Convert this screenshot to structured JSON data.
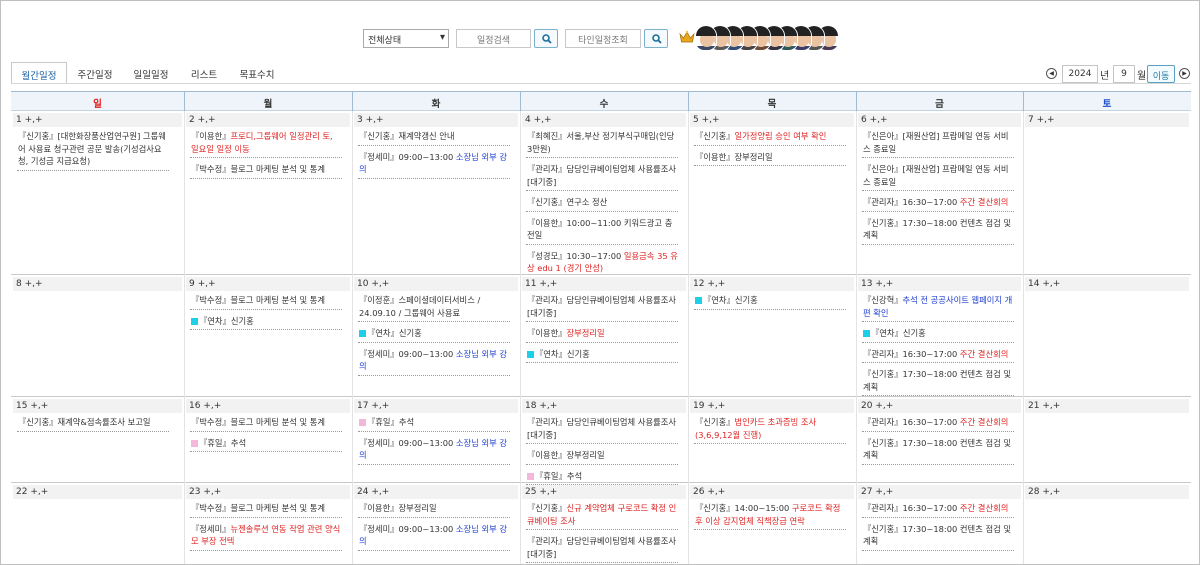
{
  "toolbar": {
    "status_select": "전체상태",
    "schedule_search_placeholder": "일정검색",
    "other_schedule_placeholder": "타인일정조회",
    "avatar_count": 10
  },
  "tabs": [
    {
      "label": "월간일정",
      "active": true
    },
    {
      "label": "주간일정",
      "active": false
    },
    {
      "label": "일일일정",
      "active": false
    },
    {
      "label": "리스트",
      "active": false
    },
    {
      "label": "목표수치",
      "active": false
    }
  ],
  "nav": {
    "prev": "◀",
    "next": "▶",
    "year": "2024",
    "year_label": "년",
    "month": "9",
    "month_label": "월",
    "go_label": "이동"
  },
  "colors": {
    "red": "#e02323",
    "blue": "#1f3fd1",
    "cyan_square": "#1ecfe8",
    "pink_square": "#f2b8da"
  },
  "calendar": {
    "days": [
      "일",
      "월",
      "화",
      "수",
      "목",
      "금",
      "토"
    ],
    "weeks": [
      [
        {
          "day": "1 +,+",
          "events": [
            {
              "t": [
                {
                  "s": "『신기홍』[대한화장품산업연구원] 그룹웨어 사용료 청구관련 공문 발송(기성검사요청, 기성금 지급요청)"
                }
              ]
            }
          ]
        },
        {
          "day": "2 +,+",
          "events": [
            {
              "t": [
                {
                  "s": "『이용한』"
                },
                {
                  "s": "프로디,그룹웨어 일정관리 토, 일요일 일정 이동",
                  "c": "red"
                }
              ]
            },
            {
              "t": [
                {
                  "s": "『박수정』블로그 마케팅 분석 및 통계"
                }
              ]
            }
          ]
        },
        {
          "day": "3 +,+",
          "events": [
            {
              "t": [
                {
                  "s": "『신기홍』재계약갱신 안내"
                }
              ]
            },
            {
              "t": [
                {
                  "s": "『정세미』09:00~13:00 "
                },
                {
                  "s": "소장님 외부 강의",
                  "c": "blue"
                }
              ]
            }
          ]
        },
        {
          "day": "4 +,+",
          "events": [
            {
              "t": [
                {
                  "s": "『최혜진』서울,부산 정기부식구매입(인당3만원)"
                }
              ]
            },
            {
              "t": [
                {
                  "s": "『관리자』담당인큐베이팅업체 사용률조사 [대기중]"
                }
              ]
            },
            {
              "t": [
                {
                  "s": "『신기홍』연구소 정산"
                }
              ]
            },
            {
              "t": [
                {
                  "s": "『이용한』10:00~11:00 키워드광고 충전일"
                }
              ]
            },
            {
              "t": [
                {
                  "s": "『성경모』10:30~17:00 "
                },
                {
                  "s": "일용금속 35 유상 edu 1 (경기 안성)",
                  "c": "red"
                }
              ]
            }
          ]
        },
        {
          "day": "5 +,+",
          "events": [
            {
              "t": [
                {
                  "s": "『신기홍』"
                },
                {
                  "s": "일가정양립 승인 여부 확인",
                  "c": "red"
                }
              ]
            },
            {
              "t": [
                {
                  "s": "『이용한』장부정리일"
                }
              ]
            }
          ]
        },
        {
          "day": "6 +,+",
          "events": [
            {
              "t": [
                {
                  "s": "『신은아』[재원산업] 프랍메일 연동 서비스 종료일"
                }
              ]
            },
            {
              "t": [
                {
                  "s": "『신은아』[재원산업] 프랍메일 연동 서비스 종료일"
                }
              ]
            },
            {
              "t": [
                {
                  "s": "『관리자』16:30~17:00 "
                },
                {
                  "s": "주간 결산회의",
                  "c": "red"
                }
              ]
            },
            {
              "t": [
                {
                  "s": "『신기홍』17:30~18:00 컨텐츠 점검 및 계획"
                }
              ]
            }
          ]
        },
        {
          "day": "7 +,+",
          "events": []
        }
      ],
      [
        {
          "day": "8 +,+",
          "events": []
        },
        {
          "day": "9 +,+",
          "events": [
            {
              "t": [
                {
                  "s": "『박수정』블로그 마케팅 분석 및 통계"
                }
              ]
            },
            {
              "sq": "cyan",
              "t": [
                {
                  "s": "『연차』신기홍"
                }
              ]
            }
          ]
        },
        {
          "day": "10 +,+",
          "events": [
            {
              "t": [
                {
                  "s": "『이정훈』스페이셜데이터서비스 / 24.09.10 / 그룹웨어 사용료"
                }
              ]
            },
            {
              "sq": "cyan",
              "t": [
                {
                  "s": "『연차』신기홍"
                }
              ]
            },
            {
              "t": [
                {
                  "s": "『정세미』09:00~13:00 "
                },
                {
                  "s": "소장님 외부 강의",
                  "c": "blue"
                }
              ]
            }
          ]
        },
        {
          "day": "11 +,+",
          "events": [
            {
              "t": [
                {
                  "s": "『관리자』담당인큐베이팅업체 사용률조사 [대기중]"
                }
              ]
            },
            {
              "t": [
                {
                  "s": "『이용한』"
                },
                {
                  "s": "장부정리일",
                  "c": "red"
                }
              ]
            },
            {
              "sq": "cyan",
              "t": [
                {
                  "s": "『연차』신기홍"
                }
              ]
            }
          ]
        },
        {
          "day": "12 +,+",
          "events": [
            {
              "sq": "cyan",
              "t": [
                {
                  "s": "『연차』신기홍"
                }
              ]
            }
          ]
        },
        {
          "day": "13 +,+",
          "events": [
            {
              "t": [
                {
                  "s": "『신강혁』"
                },
                {
                  "s": "추석 전 공공사이트 웹페이지 개편 확인",
                  "c": "blue"
                }
              ]
            },
            {
              "sq": "cyan",
              "t": [
                {
                  "s": "『연차』신기홍"
                }
              ]
            },
            {
              "t": [
                {
                  "s": "『관리자』16:30~17:00 "
                },
                {
                  "s": "주간 결산회의",
                  "c": "red"
                }
              ]
            },
            {
              "t": [
                {
                  "s": "『신기홍』17:30~18:00 컨텐츠 점검 및 계획"
                }
              ]
            }
          ]
        },
        {
          "day": "14 +,+",
          "events": []
        }
      ],
      [
        {
          "day": "15 +,+",
          "events": [
            {
              "t": [
                {
                  "s": "『신기홍』재계약&점속률조사 보고일"
                }
              ]
            }
          ]
        },
        {
          "day": "16 +,+",
          "events": [
            {
              "t": [
                {
                  "s": "『박수정』블로그 마케팅 분석 및 통계"
                }
              ]
            },
            {
              "sq": "pink",
              "t": [
                {
                  "s": "『휴일』추석"
                }
              ]
            }
          ]
        },
        {
          "day": "17 +,+",
          "events": [
            {
              "sq": "pink",
              "t": [
                {
                  "s": "『휴일』추석"
                }
              ]
            },
            {
              "t": [
                {
                  "s": "『정세미』09:00~13:00 "
                },
                {
                  "s": "소장님 외부 강의",
                  "c": "blue"
                }
              ]
            }
          ]
        },
        {
          "day": "18 +,+",
          "events": [
            {
              "t": [
                {
                  "s": "『관리자』담당인큐베이팅업체 사용률조사 [대기중]"
                }
              ]
            },
            {
              "t": [
                {
                  "s": "『이용한』장부정리일"
                }
              ]
            },
            {
              "sq": "pink",
              "t": [
                {
                  "s": "『휴일』추석"
                }
              ]
            }
          ]
        },
        {
          "day": "19 +,+",
          "events": [
            {
              "t": [
                {
                  "s": "『신기홍』"
                },
                {
                  "s": "법인카드 초과증빙 조사 (3,6,9,12월 진행)",
                  "c": "red"
                }
              ]
            }
          ]
        },
        {
          "day": "20 +,+",
          "events": [
            {
              "t": [
                {
                  "s": "『관리자』16:30~17:00 "
                },
                {
                  "s": "주간 결산회의",
                  "c": "red"
                }
              ]
            },
            {
              "t": [
                {
                  "s": "『신기홍』17:30~18:00 컨텐츠 점검 및 계획"
                }
              ]
            }
          ]
        },
        {
          "day": "21 +,+",
          "events": []
        }
      ],
      [
        {
          "day": "22 +,+",
          "events": []
        },
        {
          "day": "23 +,+",
          "events": [
            {
              "t": [
                {
                  "s": "『박수정』블로그 마케팅 분석 및 통계"
                }
              ]
            },
            {
              "t": [
                {
                  "s": "『정세미』"
                },
                {
                  "s": "뉴젠솔루션 연동 작업 관련 양식모 부장 전텍",
                  "c": "red"
                }
              ]
            }
          ]
        },
        {
          "day": "24 +,+",
          "events": [
            {
              "t": [
                {
                  "s": "『이용한』장부정리일"
                }
              ]
            },
            {
              "t": [
                {
                  "s": "『정세미』09:00~13:00 "
                },
                {
                  "s": "소장님 외부 강의",
                  "c": "blue"
                }
              ]
            }
          ]
        },
        {
          "day": "25 +,+",
          "events": [
            {
              "t": [
                {
                  "s": "『신기홍』"
                },
                {
                  "s": "신규 계약업체 구로코드 확정 인큐베이팅 조사",
                  "c": "red"
                }
              ]
            },
            {
              "t": [
                {
                  "s": "『관리자』담당인큐베이팅업체 사용률조사 [대기중]"
                }
              ]
            }
          ]
        },
        {
          "day": "26 +,+",
          "events": [
            {
              "t": [
                {
                  "s": "『신기홍』14:00~15:00 "
                },
                {
                  "s": "구로코드 확정 후 이상 감지업체 직책장급 연락",
                  "c": "red"
                }
              ]
            }
          ]
        },
        {
          "day": "27 +,+",
          "events": [
            {
              "t": [
                {
                  "s": "『관리자』16:30~17:00 "
                },
                {
                  "s": "주간 결산회의",
                  "c": "red"
                }
              ]
            },
            {
              "t": [
                {
                  "s": "『신기홍』17:30~18:00 컨텐츠 점검 및 계획"
                }
              ]
            }
          ]
        },
        {
          "day": "28 +,+",
          "events": []
        }
      ]
    ]
  }
}
